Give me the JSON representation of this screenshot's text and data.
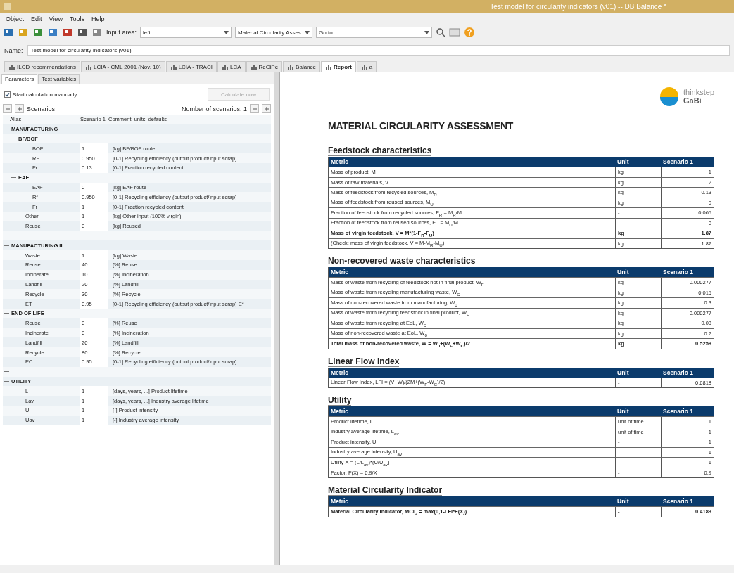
{
  "window": {
    "title": "Test model for circularity indicators (v01) -- DB Balance *"
  },
  "menu": [
    "Object",
    "Edit",
    "View",
    "Tools",
    "Help"
  ],
  "toolbar": {
    "input_area_label": "Input area:",
    "input_area_value": "left",
    "report_select": "Material Circularity Asses",
    "goto_value": "Go to"
  },
  "name_field": {
    "label": "Name:",
    "value": "Test model for circularity indicators (v01)"
  },
  "tabs": [
    {
      "label": "ILCD recommendations",
      "selected": false
    },
    {
      "label": "LCIA - CML 2001 (Nov. 10)",
      "selected": false
    },
    {
      "label": "LCIA - TRACI",
      "selected": false
    },
    {
      "label": "LCA",
      "selected": false
    },
    {
      "label": "ReCiPe",
      "selected": false
    },
    {
      "label": "Balance",
      "selected": false
    },
    {
      "label": "Report",
      "selected": true
    },
    {
      "label": "a",
      "selected": false
    }
  ],
  "parameters": {
    "subtabs": [
      {
        "label": "Parameters",
        "selected": true
      },
      {
        "label": "Text variables",
        "selected": false
      }
    ],
    "manual_calc": {
      "label": "Start calculation manually",
      "checked": true
    },
    "calc_button": {
      "label": "Calculate now",
      "disabled": true
    },
    "scenarios_label": "Scenarios",
    "scenario_count": "Number of scenarios: 1",
    "columns": [
      "Alias",
      "Scenario 1",
      "Comment, units, defaults"
    ],
    "rows": [
      {
        "alias": "MANUFACTURING",
        "expanded": true,
        "children": [
          {
            "alias": "BF/BOF",
            "expanded": true,
            "children": [
              {
                "alias": "BOF",
                "value": "1",
                "comment": "[kg] BF/BOF route"
              },
              {
                "alias": "RF",
                "value": "0.950",
                "comment": "[0-1] Recycling efficiency (output product/input scrap)"
              },
              {
                "alias": "Fr",
                "value": "0.13",
                "comment": "[0-1] Fraction recycled content"
              }
            ]
          },
          {
            "alias": "EAF",
            "expanded": true,
            "children": [
              {
                "alias": "EAF",
                "value": "0",
                "comment": "[kg] EAF route"
              },
              {
                "alias": "Rf",
                "value": "0.950",
                "comment": "[0-1] Recycling efficiency (output product/input scrap)"
              },
              {
                "alias": "Fr",
                "value": "1",
                "comment": "[0-1] Fraction recycled content"
              }
            ]
          },
          {
            "alias": "Other",
            "value": "1",
            "comment": "[kg] Other input (100% virgin)"
          },
          {
            "alias": "Reuse",
            "value": "0",
            "comment": "[kg] Reused"
          }
        ]
      },
      {
        "kind": "spacer",
        "expanded": true
      },
      {
        "alias": "MANUFACTURING II",
        "expanded": true,
        "children": [
          {
            "alias": "Waste",
            "value": "1",
            "comment": "[kg] Waste"
          },
          {
            "alias": "Reuse",
            "value": "40",
            "comment": "[%] Reuse"
          },
          {
            "alias": "Incinerate",
            "value": "10",
            "comment": "[%] Incineration"
          },
          {
            "alias": "Landfill",
            "value": "20",
            "comment": "[%] Landfill"
          },
          {
            "alias": "Recycle",
            "value": "30",
            "comment": "[%] Recycle"
          },
          {
            "alias": "ET",
            "value": "0.95",
            "comment": "[0-1] Recycling efficiency (output product/input scrap) E*"
          }
        ]
      },
      {
        "alias": "END OF LIFE",
        "expanded": true,
        "children": [
          {
            "alias": "Reuse",
            "value": "0",
            "comment": "[%] Reuse"
          },
          {
            "alias": "Incinerate",
            "value": "0",
            "comment": "[%] Incineration"
          },
          {
            "alias": "Landfill",
            "value": "20",
            "comment": "[%] Landfill"
          },
          {
            "alias": "Recycle",
            "value": "80",
            "comment": "[%] Recycle"
          },
          {
            "alias": "EC",
            "value": "0.95",
            "comment": "[0-1] Recycling efficiency (output product/input scrap)"
          }
        ]
      },
      {
        "kind": "spacer",
        "expanded": true
      },
      {
        "alias": "UTILITY",
        "expanded": true,
        "children": [
          {
            "alias": "L",
            "value": "1",
            "comment": "[days, years, ...] Product lifetime"
          },
          {
            "alias": "Lav",
            "value": "1",
            "comment": "[days, years, ...] Industry average lifetime"
          },
          {
            "alias": "U",
            "value": "1",
            "comment": "[-] Product intensity"
          },
          {
            "alias": "Uav",
            "value": "1",
            "comment": "[-] Industry average intensity"
          }
        ]
      }
    ]
  },
  "report": {
    "logo": {
      "line1": "thinkstep",
      "line2": "GaBi"
    },
    "title": "MATERIAL CIRCULARITY ASSESSMENT",
    "sections": [
      {
        "title": "Feedstock characteristics",
        "columns": [
          "Metric",
          "Unit",
          "Scenario 1"
        ],
        "rows": [
          {
            "metric": "Mass of product, M",
            "unit": "kg",
            "value": "1",
            "bold": false
          },
          {
            "metric": "Mass of raw materials, V",
            "unit": "kg",
            "value": "2",
            "bold": false
          },
          {
            "metric": "Mass of feedstock from recycled sources, M$_{R}$",
            "unit": "kg",
            "value": "0.13",
            "bold": false
          },
          {
            "metric": "Mass of feedstock from reused sources, M$_{U}$",
            "unit": "kg",
            "value": "0",
            "bold": false
          },
          {
            "metric": "Fraction of feedstock from recycled sources, F$_{R}$ = M$_{R}$/M",
            "unit": "-",
            "value": "0.065",
            "bold": false
          },
          {
            "metric": "Fraction of feedstock from reused sources, F$_{U}$ = M$_{U}$/M",
            "unit": "-",
            "value": "0",
            "bold": false
          },
          {
            "metric": "Mass of virgin feedstock, V = M*(1-F$_{R}$-F$_{U}$)",
            "unit": "kg",
            "value": "1.87",
            "bold": true
          },
          {
            "metric": "(Check: mass of virgin feedstock, V = M-M$_{R}$-M$_{U}$)",
            "unit": "kg",
            "value": "1.87",
            "bold": false
          }
        ]
      },
      {
        "title": "Non-recovered waste characteristics",
        "columns": [
          "Metric",
          "Unit",
          "Scenario 1"
        ],
        "rows": [
          {
            "metric": "Mass of waste from recycling of feedstock not in final product, W$_{F}$",
            "unit": "kg",
            "value": "0.000277",
            "bold": false
          },
          {
            "metric": "Mass of waste from recycling manufacturing waste, W$_{C}$",
            "unit": "kg",
            "value": "0.015",
            "bold": false
          },
          {
            "metric": "Mass of non-recovered waste from manufacturing, W$_{0}$",
            "unit": "kg",
            "value": "0.3",
            "bold": false
          },
          {
            "metric": "Mass of waste from recycling feedstock in final product, W$_{F}$",
            "unit": "kg",
            "value": "0.000277",
            "bold": false
          },
          {
            "metric": "Mass of waste from recycling at EoL, W$_{C}$",
            "unit": "kg",
            "value": "0.03",
            "bold": false
          },
          {
            "metric": "Mass of non-recovered waste at EoL, W$_{0}$",
            "unit": "kg",
            "value": "0.2",
            "bold": false
          },
          {
            "metric": "Total mass of non-recovered waste, W = W$_{0}$+(W$_{F}$+W$_{C}$)/2",
            "unit": "kg",
            "value": "0.5258",
            "bold": true
          }
        ]
      },
      {
        "title": "Linear Flow Index",
        "columns": [
          "Metric",
          "Unit",
          "Scenario 1"
        ],
        "rows": [
          {
            "metric": "Linear Flow Index, LFI = (V+W)/(2M+(W$_{F}$-W$_{C}$)/2)",
            "unit": "-",
            "value": "0.6818",
            "bold": false
          }
        ]
      },
      {
        "title": "Utility",
        "columns": [
          "Metric",
          "Unit",
          "Scenario 1"
        ],
        "rows": [
          {
            "metric": "Product lifetime, L",
            "unit": "unit of time",
            "value": "1",
            "bold": false
          },
          {
            "metric": "Industry average lifetime, L$_{av}$",
            "unit": "unit of time",
            "value": "1",
            "bold": false
          },
          {
            "metric": "Product intensity, U",
            "unit": "-",
            "value": "1",
            "bold": false
          },
          {
            "metric": "Industry average intensity, U$_{av}$",
            "unit": "-",
            "value": "1",
            "bold": false
          },
          {
            "metric": "Utility X = (L/L$_{av}$)*(U/U$_{av}$)",
            "unit": "-",
            "value": "1",
            "bold": false
          },
          {
            "metric": "Factor, F(X) = 0.9/X",
            "unit": "-",
            "value": "0.9",
            "bold": false
          }
        ]
      },
      {
        "title": "Material Circularity Indicator",
        "columns": [
          "Metric",
          "Unit",
          "Scenario 1"
        ],
        "rows": [
          {
            "metric": "Material Circularity Indicator, MCI$_{P}$ = max(0,1-LFI*F(X))",
            "unit": "-",
            "value": "0.4183",
            "bold": true
          }
        ]
      }
    ]
  }
}
